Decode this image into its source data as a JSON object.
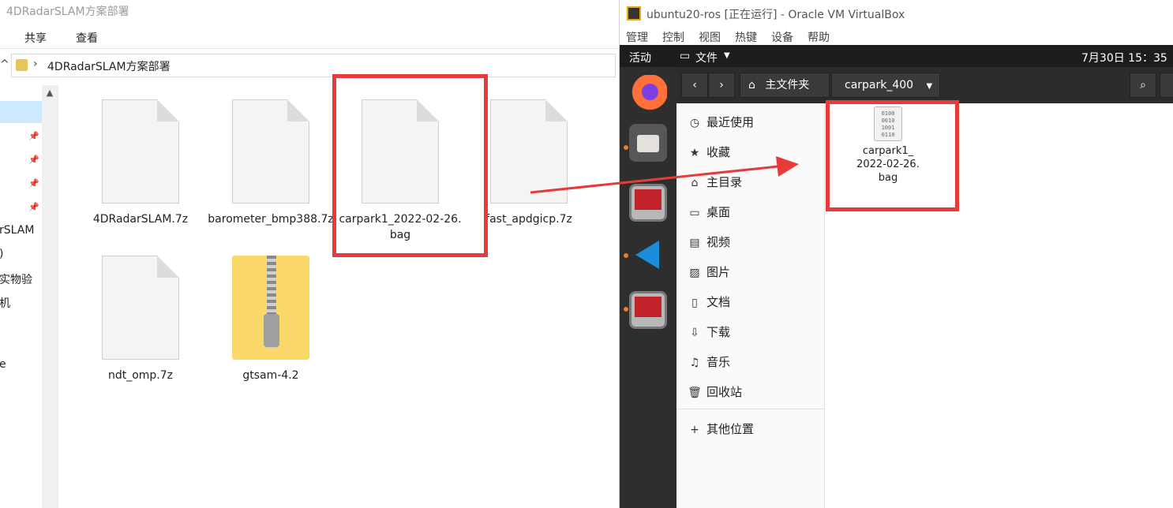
{
  "explorer": {
    "title": "4DRadarSLAM方案部署",
    "ribbon_tabs": [
      "共享",
      "查看"
    ],
    "address_path": "4DRadarSLAM方案部署",
    "nav_fragments": [
      "rSLAM",
      ")",
      "实物验",
      "机",
      "e"
    ],
    "items": [
      {
        "label": "4DRadarSLAM.7z",
        "type": "file"
      },
      {
        "label": "barometer_bmp388.7z",
        "type": "file"
      },
      {
        "label": "carpark1_2022-02-26.bag",
        "type": "file",
        "highlighted": true
      },
      {
        "label": "fast_apdgicp.7z",
        "type": "file"
      },
      {
        "label": "ndt_omp.7z",
        "type": "file"
      },
      {
        "label": "gtsam-4.2",
        "type": "zip-folder"
      }
    ]
  },
  "virtualbox": {
    "title": "ubuntu20-ros [正在运行] - Oracle VM VirtualBox",
    "menu": [
      "管理",
      "控制",
      "视图",
      "热键",
      "设备",
      "帮助"
    ],
    "ubuntu_topbar": {
      "activities": "活动",
      "app_menu": "文件",
      "clock": "7月30日 15：35"
    },
    "file_manager": {
      "home_label": "主文件夹",
      "current_folder": "carpark_400",
      "sidebar": [
        {
          "icon": "recent-icon",
          "label": "最近使用"
        },
        {
          "icon": "star-icon",
          "label": "收藏"
        },
        {
          "icon": "home-icon",
          "label": "主目录"
        },
        {
          "icon": "desktop-icon",
          "label": "桌面"
        },
        {
          "icon": "video-icon",
          "label": "视频"
        },
        {
          "icon": "picture-icon",
          "label": "图片"
        },
        {
          "icon": "document-icon",
          "label": "文档"
        },
        {
          "icon": "download-icon",
          "label": "下载"
        },
        {
          "icon": "music-icon",
          "label": "音乐"
        },
        {
          "icon": "trash-icon",
          "label": "回收站"
        }
      ],
      "other_locations": "其他位置",
      "file": {
        "label": "carpark1_\n2022-02-26.\nbag",
        "icon_text": "0100\n0010\n1001\n0110"
      }
    }
  },
  "colors": {
    "highlight_red": "#e73a3a",
    "ubuntu_dark": "#2c2c2c",
    "dock": "#2e2e2e"
  }
}
